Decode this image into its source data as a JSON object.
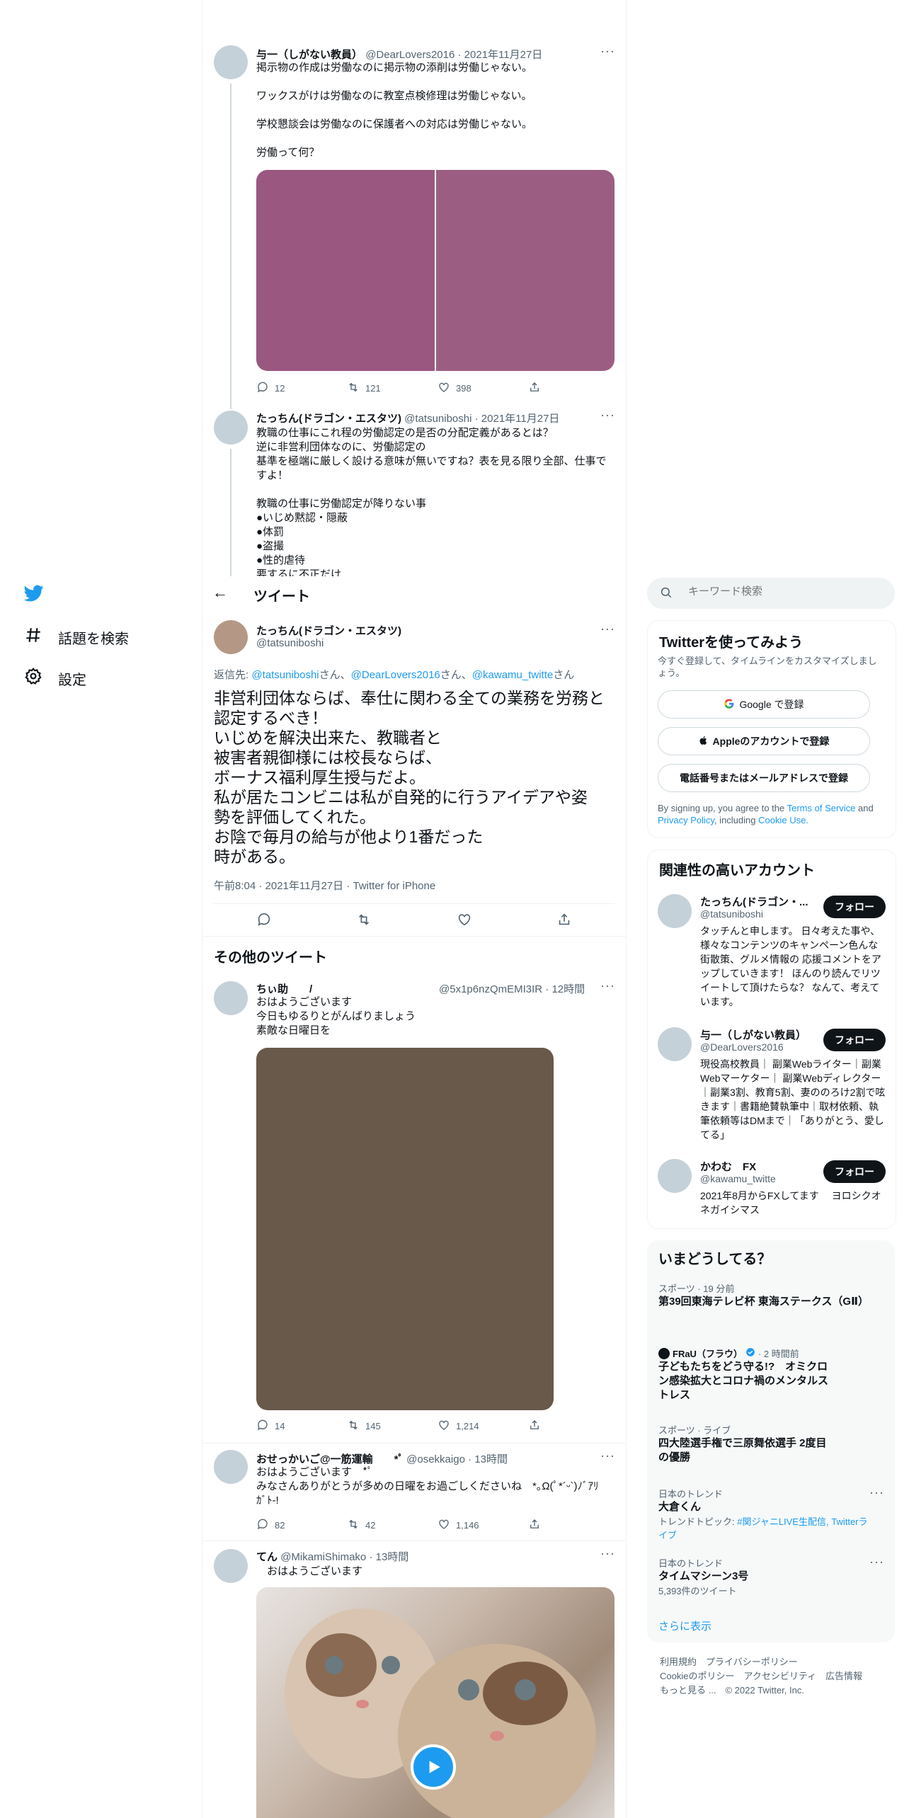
{
  "nav": {
    "explore_label": "話題を検索",
    "settings_label": "設定"
  },
  "header": {
    "title": "ツイート"
  },
  "search": {
    "placeholder": "キーワード検索"
  },
  "thread": {
    "tweet1": {
      "name": "与一（しがない教員）",
      "handle": "@DearLovers2016",
      "date": "· 2021年11月27日",
      "lines": [
        "掲示物の作成は労働なのに掲示物の添削は労働じゃない。",
        "",
        "ワックスがけは労働なのに教室点検修理は労働じゃない。",
        "",
        "学校懇談会は労働なのに保護者への対応は労働じゃない。",
        "",
        "労働って何？"
      ],
      "line1": "掲示物の作成は労働なのに掲示物の添削は労働じゃない。",
      "line2": "ワックスがけは労働なのに教室点検修理は労働じゃない。",
      "line3": "学校懇談会は労働なのに保護者への対応は労働じゃない。",
      "line4": "労働って何？",
      "replies": "12",
      "retweets": "121",
      "likes": "398",
      "image_colors": [
        "#9a577f",
        "#9b5e82"
      ]
    },
    "tweet2": {
      "name": "たっちん(ドラゴン・エスタツ)",
      "handle": "@tatsuniboshi",
      "date": "· 2021年11月27日",
      "line1": "教職の仕事にこれ程の労働認定の是否の分配定義があるとは？",
      "line2": "逆に非営利団体なのに、労働認定の",
      "line3": "基準を極端に厳しく設ける意味が無いですね？表を見る限り全部、仕事で",
      "line4": "すよ！",
      "line5": "教職の仕事に労働認定が降りない事",
      "line6": "●いじめ黙認・隠蔽",
      "line7": "●体罰",
      "line8": "●盗撮",
      "line9": "●性的虐待",
      "line10": "要するに不正だけ"
    }
  },
  "main_tweet": {
    "name": "たっちん(ドラゴン・エスタツ)",
    "handle": "@tatsuniboshi",
    "reply_prefix": "返信先: ",
    "reply_to_1": "@tatsuniboshi",
    "reply_san_1": "さん、",
    "reply_to_2": "@DearLovers2016",
    "reply_san_2": "さん、",
    "reply_to_3": "@kawamu_twitte",
    "reply_san_3": "さん",
    "text1": "非営利団体ならば、奉仕に関わる全ての業務を労務と",
    "text2": "認定するべき！",
    "text3": "いじめを解決出来た、教職者と",
    "text4": "被害者親御様には校長ならば、",
    "text5": "ボーナス福利厚生授与だよ。",
    "text6": "私が居たコンビニは私が自発的に行うアイデアや姿",
    "text7": "勢を評価してくれた。",
    "text8": "お陰で毎月の給与が他より1番だった",
    "text9": "時がある。",
    "timestamp": "午前8:04 · 2021年11月27日 · Twitter for iPhone"
  },
  "more_tweets": {
    "heading": "その他のツイート",
    "t1": {
      "name": "ちぃ助　　/",
      "handle": "@5x1p6nzQmEMI3IR",
      "time": "· 12時間",
      "line1": "おはようございます",
      "line2": "今日もゆるりとがんばりましょう",
      "line3": "素敵な日曜日を",
      "replies": "14",
      "retweets": "145",
      "likes": "1,214",
      "image_color": "#68594a"
    },
    "t2": {
      "name": "おせっかいご@一筋運輸　　*ﾟ",
      "handle": "@osekkaigo",
      "time": "· 13時間",
      "line1": "おはようございます　*ﾟ",
      "line2": "みなさんありがとうが多めの日曜をお過ごしくださいね　*｡Ω(ﾟ*´ᵕ`)ﾉﾞｱﾘ",
      "line3": "ｶﾞﾄ-!",
      "replies": "82",
      "retweets": "42",
      "likes": "1,146"
    },
    "t3": {
      "name": "てん",
      "handle": "@MikamiShimako",
      "time": "· 13時間",
      "line1": "　おはようございます"
    }
  },
  "signup": {
    "title": "Twitterを使ってみよう",
    "subtitle": "今すぐ登録して、タイムラインをカスタマイズしましょう。",
    "google": "Google で登録",
    "apple": "Appleのアカウントで登録",
    "phone": "電話番号またはメールアドレスで登録",
    "terms_prefix": "By signing up, you agree to the ",
    "terms": "Terms of Service",
    "terms_and": " and",
    "privacy": "Privacy Policy",
    "including": ", including ",
    "cookie": "Cookie Use."
  },
  "related": {
    "title": "関連性の高いアカウント",
    "follow_label": "フォロー",
    "a1": {
      "name": "たっちん(ドラゴン・...",
      "handle": "@tatsuniboshi",
      "bio": "タッチんと申します。 日々考えた事や、様々なコンテンツのキャンペーン色んな街散策、グルメ情報の 応援コメントをアップしていきます！ ほんのり読んでリツイートして頂けたらな？ なんて、考えています。"
    },
    "a2": {
      "name": "与一（しがない教員）",
      "handle": "@DearLovers2016",
      "bio": "現役高校教員｜ 副業Webライター｜副業Webマーケター｜ 副業Webディレクター｜副業3割、教育5割、妻ののろけ2割で呟きます｜書籍絶賛執筆中｜取材依頼、執筆依頼等はDMまで｜「ありがとう、愛してる」"
    },
    "a3": {
      "name": "かわむ　FX",
      "handle": "@kawamu_twitte",
      "bio": "2021年8月からFXしてます　 ヨロシクオネガイシマス"
    }
  },
  "trends": {
    "title": "いまどうしてる？",
    "t1": {
      "meta": "スポーツ · 19 分前",
      "title": "第39回東海テレビ杯 東海ステークス（GⅡ）"
    },
    "t2": {
      "source": "FRaU（フラウ）",
      "meta": "· 2 時間前",
      "title": "子どもたちをどう守る!?　オミクロン感染拡大とコロナ禍のメンタルストレス"
    },
    "t3": {
      "meta": "スポーツ · ライブ",
      "title": "四大陸選手権で三原舞依選手 2度目の優勝"
    },
    "t4": {
      "meta": "日本のトレンド",
      "title": "大倉くん",
      "topic_prefix": "トレンドトピック: ",
      "topic": "#関ジャニLIVE生配信, Twitterライブ"
    },
    "t5": {
      "meta": "日本のトレンド",
      "title": "タイムマシーン3号",
      "count": "5,393件のツイート"
    },
    "show_more": "さらに表示"
  },
  "footer": {
    "line1": "利用規約　プライバシーポリシー",
    "line2": "Cookieのポリシー　アクセシビリティ　広告情報",
    "line3": "もっと見る ...　© 2022 Twitter, Inc."
  }
}
